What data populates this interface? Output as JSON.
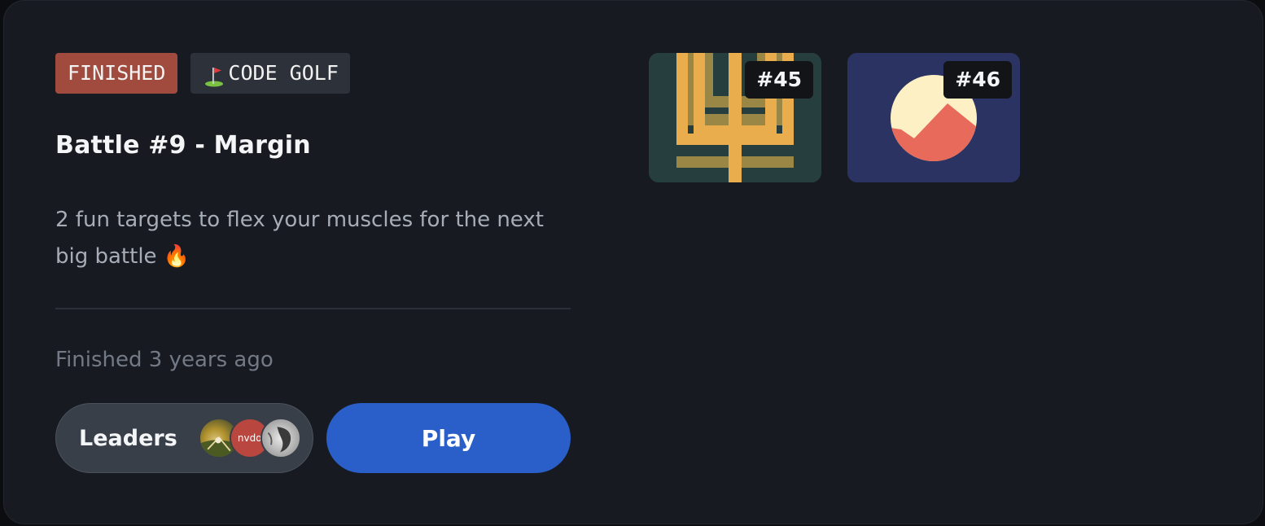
{
  "badges": {
    "status": "FINISHED",
    "mode": "CODE GOLF",
    "mode_icon": "golf-flag-icon"
  },
  "battle": {
    "title": "Battle #9 - Margin",
    "description": "2 fun targets to flex your muscles for the next big battle 🔥",
    "status_text": "Finished 3 years ago"
  },
  "actions": {
    "leaders_label": "Leaders",
    "leader_avatars": [
      {
        "label": ""
      },
      {
        "label": "nvdo"
      },
      {
        "label": ""
      }
    ],
    "play_label": "Play"
  },
  "targets": [
    {
      "number": "#45",
      "background": "#263f3e",
      "colors": [
        "#e9ad4d",
        "#9a8745"
      ]
    },
    {
      "number": "#46",
      "background": "#2b3362",
      "colors": [
        "#fdf0c5",
        "#e86a5b"
      ]
    }
  ],
  "colors": {
    "card_bg": "#171a20",
    "finished_badge": "#a14b3f",
    "play_button": "#2a5fc9",
    "leaders_button": "#383f48"
  }
}
